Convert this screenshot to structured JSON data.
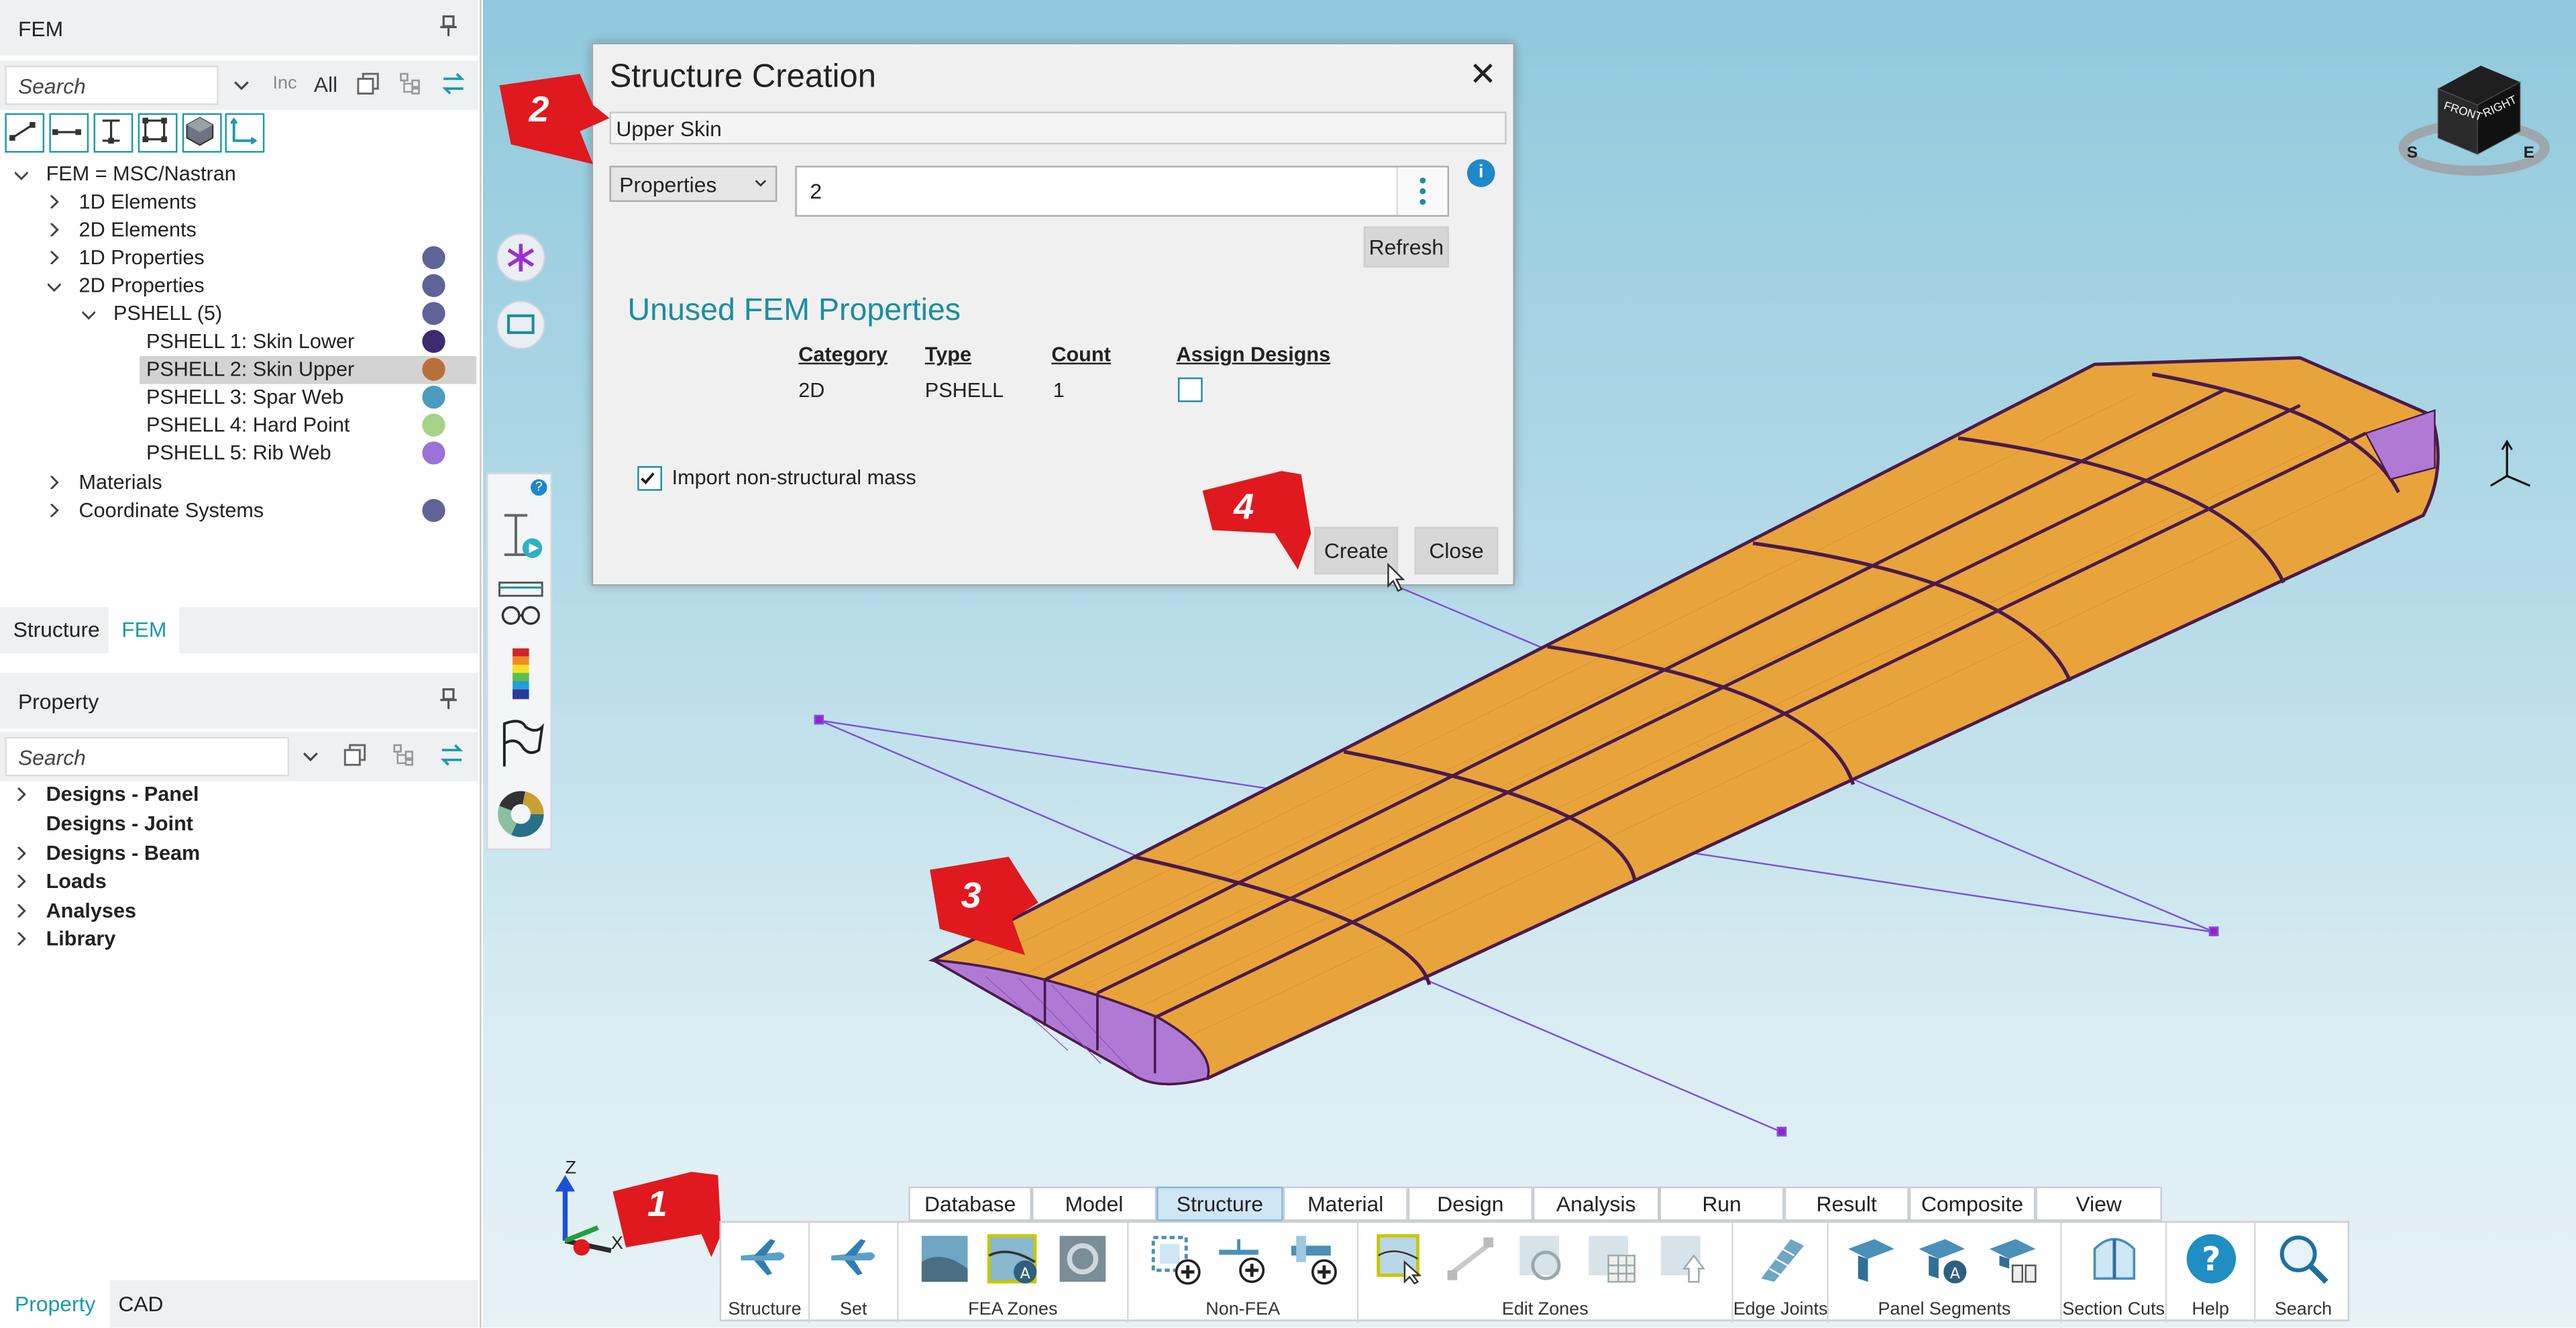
{
  "fem_panel": {
    "title": "FEM",
    "search_placeholder": "Search",
    "inc_label": "Inc",
    "all_label": "All",
    "tree": [
      {
        "label": "FEM = MSC/Nastran",
        "level": 0,
        "state": "expanded"
      },
      {
        "label": "1D Elements",
        "level": 1,
        "state": "collapsed"
      },
      {
        "label": "2D Elements",
        "level": 1,
        "state": "collapsed"
      },
      {
        "label": "1D Properties",
        "level": 1,
        "state": "collapsed",
        "color": "#5f6498"
      },
      {
        "label": "2D Properties",
        "level": 1,
        "state": "expanded",
        "color": "#5f6498"
      },
      {
        "label": "PSHELL (5)",
        "level": 2,
        "state": "expanded",
        "color": "#5f6498"
      },
      {
        "label": "PSHELL 1: Skin Lower",
        "level": 3,
        "color": "#3e2a6e"
      },
      {
        "label": "PSHELL 2: Skin Upper",
        "level": 3,
        "color": "#b8703a",
        "selected": true
      },
      {
        "label": "PSHELL 3: Spar Web",
        "level": 3,
        "color": "#4b9bc0"
      },
      {
        "label": "PSHELL 4: Hard Point",
        "level": 3,
        "color": "#a6d28a"
      },
      {
        "label": "PSHELL 5: Rib Web",
        "level": 3,
        "color": "#9a72d8"
      },
      {
        "label": "Materials",
        "level": 1,
        "state": "collapsed"
      },
      {
        "label": "Coordinate Systems",
        "level": 1,
        "state": "collapsed",
        "color": "#5f6498"
      }
    ],
    "tabs": [
      "Structure",
      "FEM"
    ]
  },
  "property_panel": {
    "title": "Property",
    "search_placeholder": "Search",
    "tree": [
      {
        "label": "Designs - Panel",
        "expandable": true
      },
      {
        "label": "Designs - Joint",
        "expandable": false
      },
      {
        "label": "Designs - Beam",
        "expandable": true
      },
      {
        "label": "Loads",
        "expandable": true
      },
      {
        "label": "Analyses",
        "expandable": true
      },
      {
        "label": "Library",
        "expandable": true
      }
    ],
    "bottom_tabs": [
      "Property",
      "CAD"
    ]
  },
  "dialog": {
    "title": "Structure Creation",
    "close_glyph": "✕",
    "name_value": "Upper Skin",
    "mode_value": "Properties",
    "ids_value": "2",
    "refresh_label": "Refresh",
    "info_glyph": "i",
    "section_title": "Unused FEM Properties",
    "table_headers": [
      "Category",
      "Type",
      "Count",
      "Assign Designs"
    ],
    "table_row": {
      "category": "2D",
      "type": "PSHELL",
      "count": "1",
      "assign": false
    },
    "import_label": "Import non-structural mass",
    "import_checked": true,
    "create_label": "Create",
    "close_label": "Close"
  },
  "callouts": [
    "1",
    "2",
    "3",
    "4"
  ],
  "viewcube": {
    "front": "FRONT",
    "right": "RIGHT",
    "south": "S",
    "east": "E"
  },
  "triad": {
    "z": "Z",
    "x": "X"
  },
  "ribbon": {
    "tabs": [
      {
        "label": "Database"
      },
      {
        "label": "Model"
      },
      {
        "label": "Structure",
        "active": true
      },
      {
        "label": "Material"
      },
      {
        "label": "Design"
      },
      {
        "label": "Analysis"
      },
      {
        "label": "Run"
      },
      {
        "label": "Result"
      },
      {
        "label": "Composite"
      },
      {
        "label": "View"
      }
    ],
    "groups": [
      "Structure",
      "Set",
      "FEA Zones",
      "Non-FEA",
      "Edit Zones",
      "Edge Joints",
      "Panel Segments",
      "Section Cuts",
      "Help",
      "Search"
    ]
  },
  "colors": {
    "accent": "#1a9aaa",
    "callout": "#e0191e",
    "wing": "#e7a33a",
    "wing_edge": "#4b1a4e",
    "selection": "#7a2bd6"
  }
}
